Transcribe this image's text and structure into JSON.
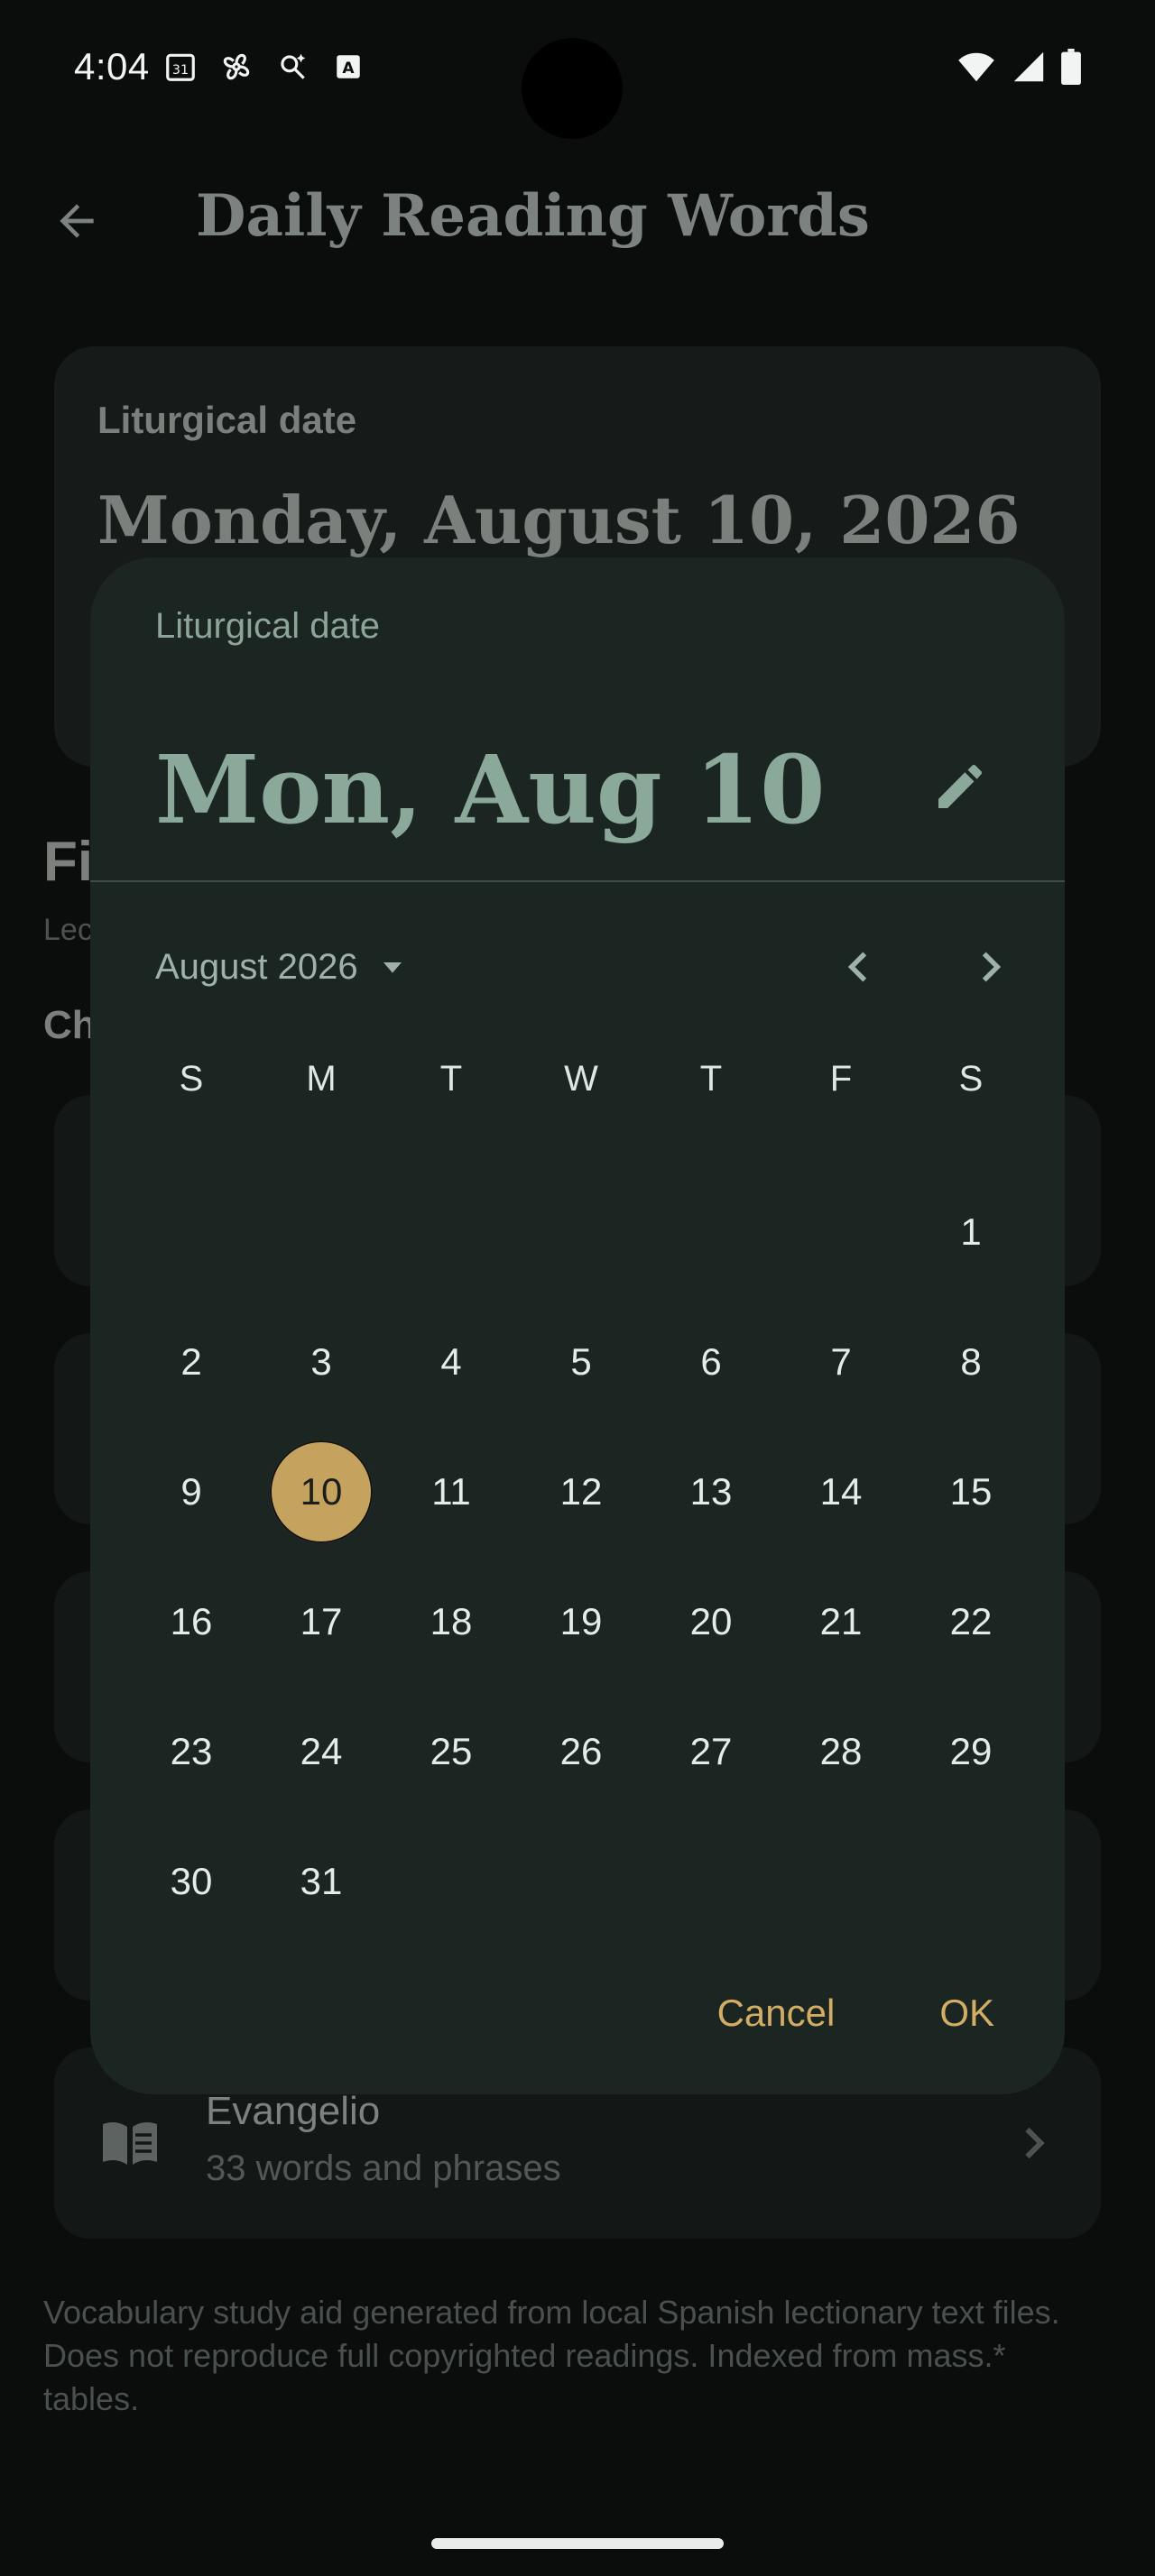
{
  "status_bar": {
    "time": "4:04",
    "icons": [
      "calendar-icon",
      "fan-icon",
      "search-sparkle-icon",
      "a-box-icon"
    ],
    "right_icons": [
      "wifi-icon",
      "signal-icon",
      "battery-icon"
    ]
  },
  "app_bar": {
    "title": "Daily Reading Words",
    "back_icon": "arrow-back-icon"
  },
  "background": {
    "date_card": {
      "label": "Liturgical date",
      "value": "Monday, August 10, 2026"
    },
    "section_title": "Fi",
    "section_sub": "Lec",
    "section_sub2": "Ch",
    "cards": [
      {
        "title": "",
        "sub": ""
      },
      {
        "title": "",
        "sub": ""
      },
      {
        "title": "",
        "sub": ""
      },
      {
        "title": "",
        "sub": ""
      },
      {
        "title": "Evangelio",
        "sub": "33 words and phrases"
      }
    ],
    "footer": "Vocabulary study aid generated from local Spanish lectionary text files. Does not reproduce full copyrighted readings. Indexed from mass.* tables."
  },
  "dialog": {
    "label": "Liturgical date",
    "selected_date": "Mon, Aug 10",
    "month_label": "August 2026",
    "weekdays": [
      "S",
      "M",
      "T",
      "W",
      "T",
      "F",
      "S"
    ],
    "days": [
      "",
      "",
      "",
      "",
      "",
      "",
      "1",
      "2",
      "3",
      "4",
      "5",
      "6",
      "7",
      "8",
      "9",
      "10",
      "11",
      "12",
      "13",
      "14",
      "15",
      "16",
      "17",
      "18",
      "19",
      "20",
      "21",
      "22",
      "23",
      "24",
      "25",
      "26",
      "27",
      "28",
      "29",
      "30",
      "31"
    ],
    "selected_day": "10",
    "cancel_label": "Cancel",
    "ok_label": "OK"
  },
  "colors": {
    "accent": "#c5a35f",
    "dialog_bg": "#1b2622",
    "screen_bg": "#0b0d0c",
    "headline": "#8aa99a"
  }
}
